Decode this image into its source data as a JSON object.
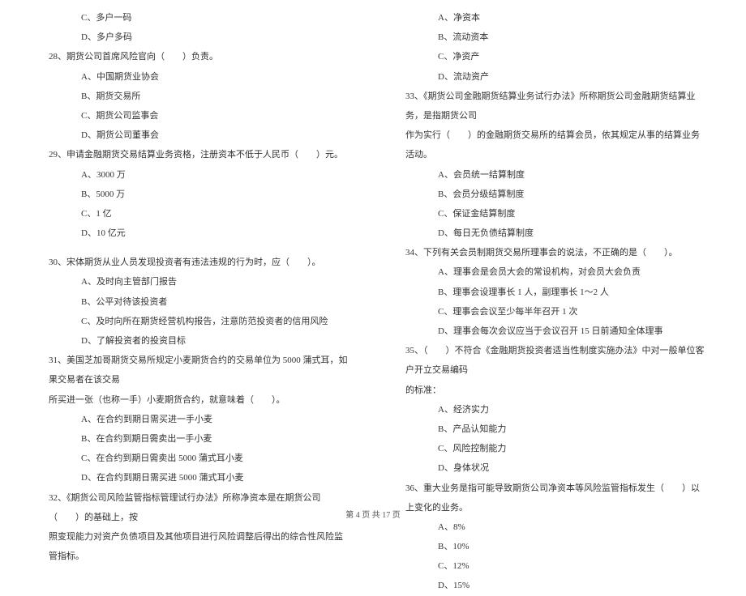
{
  "left": {
    "q27": {
      "optC": "C、多户一码",
      "optD": "D、多户多码"
    },
    "q28": {
      "text": "28、期货公司首席风险官向（　　）负责。",
      "optA": "A、中国期货业协会",
      "optB": "B、期货交易所",
      "optC": "C、期货公司监事会",
      "optD": "D、期货公司董事会"
    },
    "q29": {
      "text": "29、申请金融期货交易结算业务资格，注册资本不低于人民币（　　）元。",
      "optA": "A、3000 万",
      "optB": "B、5000 万",
      "optC": "C、1 亿",
      "optD": "D、10 亿元"
    },
    "q30": {
      "text": "30、宋体期货从业人员发现投资者有违法违规的行为时，应（　　）。",
      "optA": "A、及时向主管部门报告",
      "optB": "B、公平对待该投资者",
      "optC": "C、及时向所在期货经营机构报告，注意防范投资者的信用风险",
      "optD": "D、了解投资者的投资目标"
    },
    "q31": {
      "text": "31、美国芝加哥期货交易所规定小麦期货合约的交易单位为 5000 蒲式耳，如果交易者在该交易",
      "text2": "所买进一张（也称一手）小麦期货合约，就意味着（　　）。",
      "optA": "A、在合约到期日需买进一手小麦",
      "optB": "B、在合约到期日需卖出一手小麦",
      "optC": "C、在合约到期日需卖出 5000 蒲式耳小麦",
      "optD": "D、在合约到期日需买进 5000 蒲式耳小麦"
    },
    "q32": {
      "text": "32、《期货公司风险监管指标管理试行办法》所称净资本是在期货公司（　　）的基础上，按",
      "text2": "照变现能力对资产负债项目及其他项目进行风险调整后得出的综合性风险监管指标。"
    }
  },
  "right": {
    "q32": {
      "optA": "A、净资本",
      "optB": "B、流动资本",
      "optC": "C、净资产",
      "optD": "D、流动资产"
    },
    "q33": {
      "text": "33、《期货公司金融期货结算业务试行办法》所称期货公司金融期货结算业务，是指期货公司",
      "text2": "作为实行（　　）的金融期货交易所的结算会员，依其规定从事的结算业务活动。",
      "optA": "A、会员统一结算制度",
      "optB": "B、会员分级结算制度",
      "optC": "C、保证金结算制度",
      "optD": "D、每日无负债结算制度"
    },
    "q34": {
      "text": "34、下列有关会员制期货交易所理事会的说法，不正确的是（　　）。",
      "optA": "A、理事会是会员大会的常设机构，对会员大会负责",
      "optB": "B、理事会设理事长 1 人，副理事长 1～2 人",
      "optC": "C、理事会会议至少每半年召开 1 次",
      "optD": "D、理事会每次会议应当于会议召开 15 日前通知全体理事"
    },
    "q35": {
      "text": "35、（　　）不符合《金融期货投资者适当性制度实施办法》中对一般单位客户开立交易编码",
      "text2": "的标准：",
      "optA": "A、经济实力",
      "optB": "B、产品认知能力",
      "optC": "C、风险控制能力",
      "optD": "D、身体状况"
    },
    "q36": {
      "text": "36、重大业务是指可能导致期货公司净资本等风险监管指标发生（　　）以上变化的业务。",
      "optA": "A、8%",
      "optB": "B、10%",
      "optC": "C、12%",
      "optD": "D、15%"
    }
  },
  "footer": "第 4 页 共 17 页"
}
